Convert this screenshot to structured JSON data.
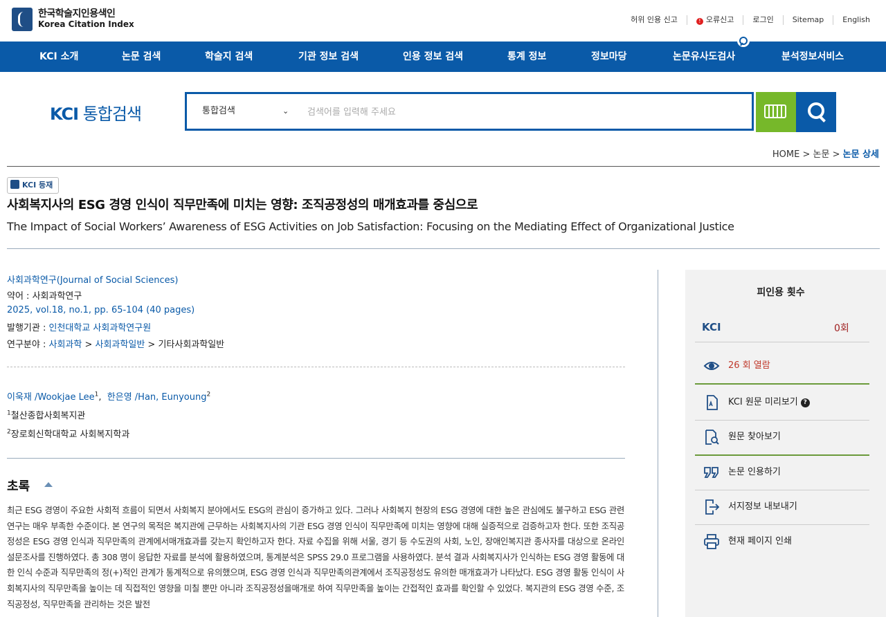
{
  "header": {
    "logo_ko": "한국학술지인용색인",
    "logo_en": "Korea Citation Index",
    "util_links": [
      "허위 인용 신고",
      "오류신고",
      "로그인",
      "Sitemap",
      "English"
    ]
  },
  "nav": {
    "items": [
      "KCI 소개",
      "논문 검색",
      "학술지 검색",
      "기관 정보 검색",
      "인용 정보 검색",
      "통계 정보",
      "정보마당",
      "논문유사도검사",
      "분석정보서비스"
    ]
  },
  "search": {
    "brand": "KCI",
    "brand_suffix": "통합검색",
    "scope": "통합검색",
    "placeholder": "검색어를 입력해 주세요"
  },
  "breadcrumb": {
    "home": "HOME",
    "sep": ">",
    "mid": "논문",
    "current": "논문 상세"
  },
  "article": {
    "badge": "KCI 등재",
    "title_ko": "사회복지사의 ESG 경영 인식이 직무만족에 미치는 영향: 조직공정성의 매개효과를 중심으로",
    "title_en": "The Impact of Social Workers’ Awareness of ESG Activities on Job Satisfaction: Focusing on the Mediating Effect of Organizational Justice",
    "journal": "사회과학연구(Journal of Social Sciences)",
    "abbr_label": "약어 : ",
    "abbr": "사회과학연구",
    "issue": "2025, vol.18, no.1, pp. 65-104 (40 pages)",
    "publisher_label": "발행기관 : ",
    "publisher": "인천대학교 사회과학연구원",
    "field_label": "연구분야 : ",
    "field_1": "사회과학",
    "field_2": "사회과학일반",
    "field_3": "기타사회과학일반",
    "authors": [
      {
        "name": "이욱재 /Wookjae Lee",
        "sup": "1"
      },
      {
        "name": "한은영 /Han, Eunyoung",
        "sup": "2"
      }
    ],
    "affiliations": [
      {
        "sup": "1",
        "name": "철산종합사회복지관"
      },
      {
        "sup": "2",
        "name": "장로회신학대학교 사회복지학과"
      }
    ],
    "abstract_heading": "초록",
    "abstract": "최근 ESG 경영이 주요한 사회적 흐름이 되면서 사회복지 분야에서도 ESG의 관심이 증가하고 있다. 그러나 사회복지 현장의 ESG 경영에 대한 높은 관심에도 불구하고 ESG 관련 연구는 매우 부족한 수준이다. 본 연구의 목적은 복지관에 근무하는 사회복지사의 기관 ESG 경영 인식이 직무만족에 미치는 영향에 대해 실증적으로 검증하고자 한다. 또한 조직공정성은 ESG 경영 인식과 직무만족의 관계에서매개효과를 갖는지 확인하고자 한다. 자료 수집을 위해 서울, 경기 등 수도권의 사회, 노인, 장애인복지관 종사자를 대상으로 온라인 설문조사를 진행하였다. 총 308 명이 응답한 자료를 분석에 활용하였으며, 통계분석은 SPSS 29.0 프로그램을 사용하였다. 분석 결과 사회복지사가 인식하는 ESG 경영 활동에 대한 인식 수준과 직무만족의 정(+)적인 관계가 통계적으로 유의했으며, ESG 경영 인식과 직무만족의관계에서 조직공정성도 유의한 매개효과가 나타났다. ESG 경영 활동 인식이 사회복지사의 직무만족을 높이는 데 직접적인 영향을 미칠 뿐만 아니라 조직공정성을매개로 하여 직무만족을 높이는 간접적인 효과를 확인할 수 있었다. 복지관의 ESG 경영 수준, 조직공정성, 직무만족을 관리하는 것은 발전"
  },
  "panel": {
    "heading": "피인용 횟수",
    "kci_label": "KCI",
    "kci_count": "0회",
    "views": "26 회 열람",
    "preview": "KCI 원문 미리보기",
    "find_original": "원문 찾아보기",
    "cite": "논문 인용하기",
    "export": "서지정보 내보내기",
    "print": "현재 페이지 인쇄"
  }
}
